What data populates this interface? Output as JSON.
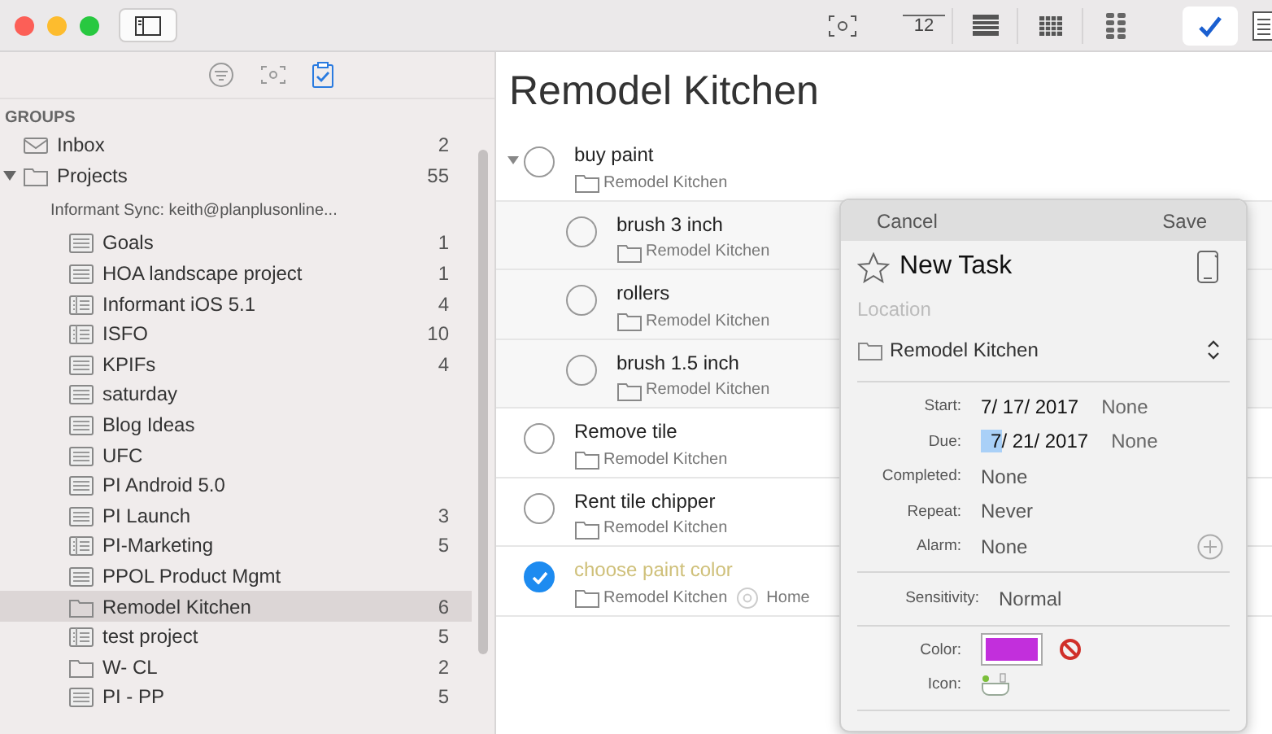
{
  "toolbar": {
    "right_items": [
      {
        "kind": "focus"
      },
      {
        "kind": "calendar",
        "label": "12"
      },
      {
        "kind": "table"
      },
      {
        "kind": "grid"
      },
      {
        "kind": "dots"
      },
      {
        "kind": "check",
        "selected": true
      },
      {
        "kind": "notes"
      }
    ]
  },
  "sidebar": {
    "tabs": [
      {
        "kind": "filter",
        "selected": false
      },
      {
        "kind": "focus",
        "selected": false
      },
      {
        "kind": "clipboard",
        "selected": true
      }
    ],
    "section": "GROUPS",
    "groups": [
      {
        "label": "Inbox",
        "count": "2",
        "kind": "inbox"
      },
      {
        "label": "Projects",
        "count": "55",
        "kind": "folder",
        "expanded": true
      }
    ],
    "account": "Informant Sync: keith@planplusonline...",
    "items": [
      {
        "label": "Goals",
        "count": "1",
        "kind": "list",
        "selected": false
      },
      {
        "label": "HOA landscape project",
        "count": "1",
        "kind": "list",
        "selected": false
      },
      {
        "label": "Informant iOS 5.1",
        "count": "4",
        "kind": "split",
        "selected": false
      },
      {
        "label": "ISFO",
        "count": "10",
        "kind": "split",
        "selected": false
      },
      {
        "label": "KPIFs",
        "count": "4",
        "kind": "list",
        "selected": false
      },
      {
        "label": "saturday",
        "kind": "list",
        "selected": false
      },
      {
        "label": "Blog Ideas",
        "kind": "list",
        "selected": false
      },
      {
        "label": "UFC",
        "kind": "list",
        "selected": false
      },
      {
        "label": "PI Android 5.0",
        "kind": "list",
        "selected": false
      },
      {
        "label": "PI Launch",
        "count": "3",
        "kind": "list",
        "selected": false
      },
      {
        "label": "PI-Marketing",
        "count": "5",
        "kind": "split",
        "selected": false
      },
      {
        "label": "PPOL Product Mgmt",
        "kind": "list",
        "selected": false
      },
      {
        "label": "Remodel Kitchen",
        "count": "6",
        "kind": "folder",
        "selected": true
      },
      {
        "label": "test project",
        "count": "5",
        "kind": "split",
        "selected": false
      },
      {
        "label": "W- CL",
        "count": "2",
        "kind": "folder",
        "selected": false
      },
      {
        "label": "PI - PP",
        "count": "5",
        "kind": "list",
        "selected": false
      }
    ]
  },
  "main": {
    "title": "Remodel Kitchen",
    "tasks": [
      {
        "title": "buy paint",
        "project": "Remodel Kitchen",
        "checked": false,
        "expanded": true,
        "children": [
          {
            "title": "brush 3 inch",
            "project": "Remodel Kitchen",
            "checked": false
          },
          {
            "title": "rollers",
            "project": "Remodel Kitchen",
            "checked": false
          },
          {
            "title": "brush 1.5 inch",
            "project": "Remodel Kitchen",
            "checked": false
          }
        ]
      },
      {
        "title": "Remove tile",
        "project": "Remodel Kitchen",
        "checked": false
      },
      {
        "title": "Rent tile chipper",
        "project": "Remodel Kitchen",
        "checked": false
      },
      {
        "title": "choose paint color",
        "project": "Remodel Kitchen",
        "context": "Home",
        "checked": true
      }
    ]
  },
  "popover": {
    "cancel": "Cancel",
    "save": "Save",
    "title": "New Task",
    "starred": false,
    "location_placeholder": "Location",
    "project": "Remodel Kitchen",
    "fields": [
      {
        "kind": "date",
        "label": "Start:",
        "segments": [
          {
            "text": "7",
            "selected": false
          },
          {
            "text": "/ 17/ 2017",
            "selected": false
          }
        ],
        "time": "None"
      },
      {
        "kind": "date",
        "label": "Due:",
        "segments": [
          {
            "text": "7",
            "selected": true
          },
          {
            "text": "/ 21/ 2017",
            "selected": false
          }
        ],
        "time": "None"
      },
      {
        "kind": "text",
        "label": "Completed:",
        "value": "None"
      },
      {
        "kind": "text",
        "label": "Repeat:",
        "value": "Never"
      },
      {
        "kind": "alarm",
        "label": "Alarm:",
        "value": "None"
      },
      {
        "kind": "divider"
      },
      {
        "kind": "setting",
        "label": "Sensitivity:",
        "value": "Normal"
      },
      {
        "kind": "divider"
      },
      {
        "kind": "color",
        "label": "Color:",
        "color": "#c22fdc"
      },
      {
        "kind": "icon",
        "label": "Icon:"
      },
      {
        "kind": "divider"
      }
    ]
  }
}
